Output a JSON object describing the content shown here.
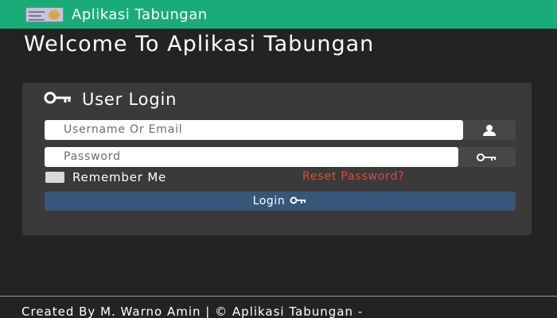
{
  "header": {
    "app_title": "Aplikasi Tabungan",
    "logo_icon": "app-logo-icon",
    "background": "#1aac78"
  },
  "welcome": {
    "title": "Welcome To Aplikasi Tabungan"
  },
  "login_panel": {
    "title": "User Login",
    "title_icon": "key-icon",
    "username": {
      "placeholder": "Username Or Email",
      "value": "",
      "icon": "user-icon"
    },
    "password": {
      "placeholder": "Password",
      "value": "",
      "icon": "key-icon"
    },
    "remember_label": "Remember Me",
    "remember_checked": false,
    "reset_link": "Reset Password?",
    "reset_color": "#e24a3b",
    "login_button": "Login",
    "login_button_icon": "key-icon",
    "login_button_color": "#36577a"
  },
  "footer": {
    "text": "Created By M. Warno Amin | © Aplikasi Tabungan -"
  }
}
